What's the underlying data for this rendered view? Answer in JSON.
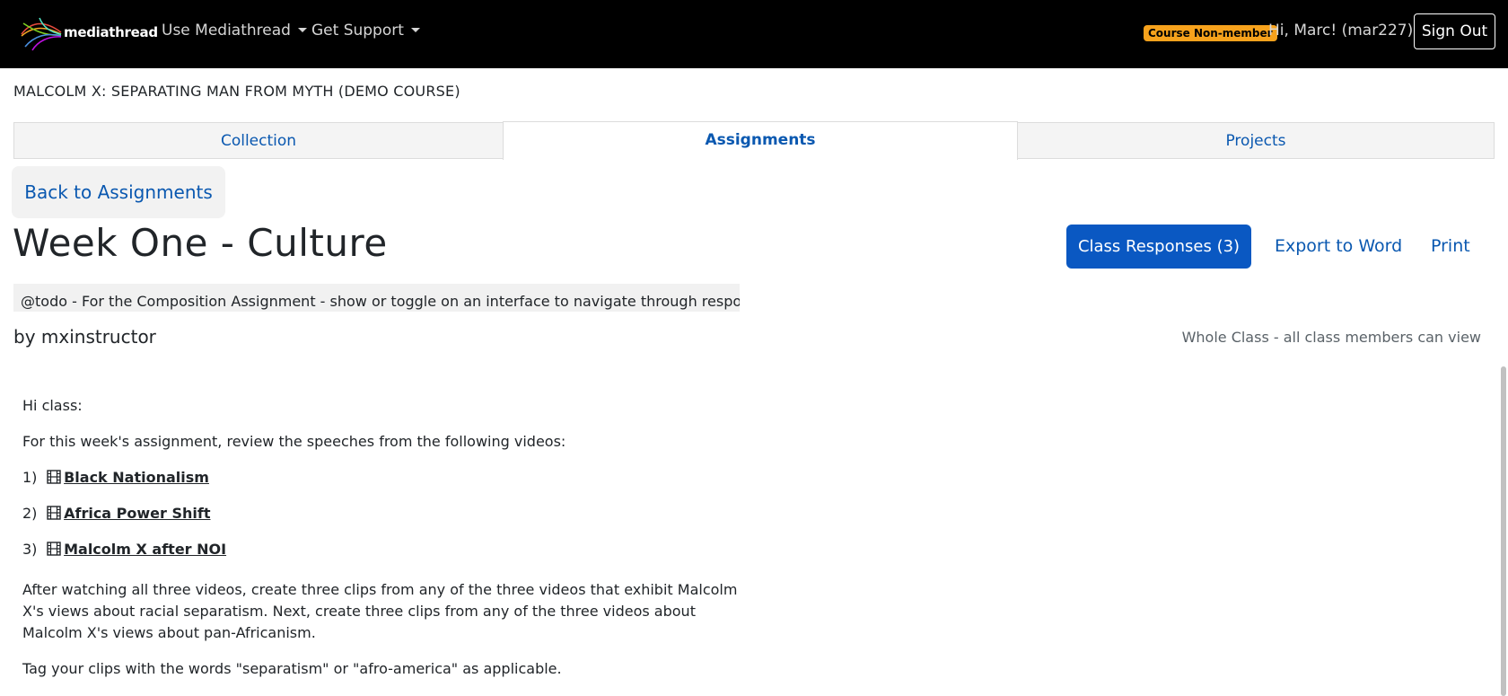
{
  "navbar": {
    "brand": "mediathread",
    "menus": [
      {
        "label": "Use Mediathread"
      },
      {
        "label": "Get Support"
      }
    ],
    "role_badge": "Course Non-member",
    "user_greeting": "Hi, Marc! (mar227)",
    "sign_out_label": "Sign Out"
  },
  "course": {
    "title": "MALCOLM X: SEPARATING MAN FROM MYTH (DEMO COURSE)"
  },
  "tabs": [
    {
      "label": "Collection",
      "active": false
    },
    {
      "label": "Assignments",
      "active": true
    },
    {
      "label": "Projects",
      "active": false
    }
  ],
  "back_button": "Back to Assignments",
  "assignment": {
    "title": "Week One - Culture",
    "actions": {
      "class_responses": "Class Responses (3)",
      "export": "Export to Word",
      "print": "Print"
    },
    "todo_note": "@todo - For the Composition Assignment - show or toggle on an interface to navigate through responses.",
    "byline": "by mxinstructor",
    "visibility": "Whole Class - all class members can view",
    "body": {
      "greeting": "Hi class:",
      "intro": "For this week's assignment, review the speeches from the following videos:",
      "videos": [
        {
          "num": "1)",
          "title": "Black Nationalism"
        },
        {
          "num": "2)",
          "title": "Africa Power Shift"
        },
        {
          "num": "3)",
          "title": "Malcolm X after NOI"
        }
      ],
      "instructions": "After watching all three videos, create three clips from any of the three videos that exhibit Malcolm X's views about racial separatism. Next, create three clips from any of the three videos about Malcolm X's views about pan-Africanism.",
      "tagging": "Tag your clips with the words \"separatism\" or \"afro-america\" as applicable."
    }
  },
  "colors": {
    "navbar_bg": "#000000",
    "badge_bg": "#f7a21c",
    "link": "#0a58b0",
    "primary": "#0a58c2"
  }
}
